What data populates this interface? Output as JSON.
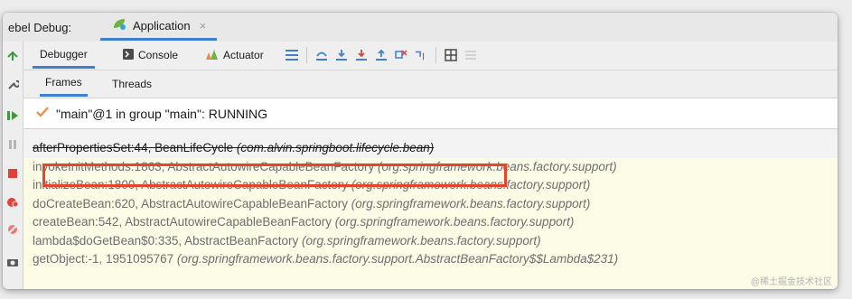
{
  "window": {
    "title_label": "ebel Debug:",
    "tab": {
      "label": "Application",
      "close": "×",
      "icon": "spring-leaf-icon"
    }
  },
  "toolbar": {
    "debugger": "Debugger",
    "console": "Console",
    "actuator": "Actuator"
  },
  "subtabs": [
    "Frames",
    "Threads"
  ],
  "thread": {
    "text": "\"main\"@1 in group \"main\": RUNNING"
  },
  "frames": [
    {
      "method": "afterPropertiesSet:44, BeanLifeCycle",
      "pkg": "(com.alvin.springboot.lifecycle.bean)"
    },
    {
      "method": "invokeInitMethods:1863, AbstractAutowireCapableBeanFactory",
      "pkg": "(org.springframework.beans.factory.support)"
    },
    {
      "method": "initializeBean:1800, AbstractAutowireCapableBeanFactory",
      "pkg": "(org.springframework.beans.factory.support)"
    },
    {
      "method": "doCreateBean:620, AbstractAutowireCapableBeanFactory",
      "pkg": "(org.springframework.beans.factory.support)"
    },
    {
      "method": "createBean:542, AbstractAutowireCapableBeanFactory",
      "pkg": "(org.springframework.beans.factory.support)"
    },
    {
      "method": "lambda$doGetBean$0:335, AbstractBeanFactory",
      "pkg": "(org.springframework.beans.factory.support)"
    },
    {
      "method": "getObject:-1, 1951095767",
      "pkg": "(org.springframework.beans.factory.support.AbstractBeanFactory$$Lambda$231)"
    }
  ],
  "watermark": "@稀土掘金技术社区",
  "colors": {
    "accent": "#3f7fd1",
    "highlight": "#e8442b",
    "frames_bg": "#fbfbe6",
    "running_check": "#f0893b"
  }
}
